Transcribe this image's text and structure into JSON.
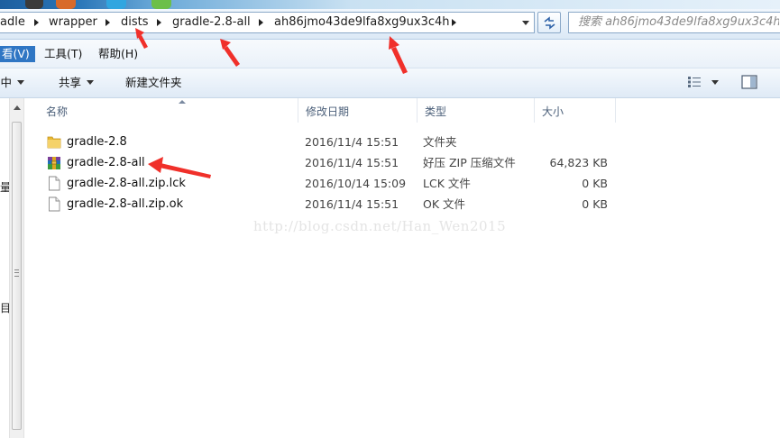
{
  "address_bar": {
    "crumbs": [
      "adle",
      "wrapper",
      "dists",
      "gradle-2.8-all",
      "ah86jmo43de9lfa8xg9ux3c4h"
    ]
  },
  "search": {
    "placeholder": "搜索 ah86jmo43de9lfa8xg9ux3c4h"
  },
  "menu": {
    "view": "看(V)",
    "tools": "工具(T)",
    "help": "帮助(H)"
  },
  "toolbar": {
    "include": "库中",
    "share": "共享",
    "new_folder": "新建文件夹"
  },
  "nav": {
    "fragment_1": "量",
    "fragment_2": "目"
  },
  "columns": {
    "name": "名称",
    "modified": "修改日期",
    "type": "类型",
    "size": "大小"
  },
  "files": [
    {
      "name": "gradle-2.8",
      "modified": "2016/11/4 15:51",
      "type": "文件夹",
      "size": "",
      "icon": "folder-icon"
    },
    {
      "name": "gradle-2.8-all",
      "modified": "2016/11/4 15:51",
      "type": "好压 ZIP 压缩文件",
      "size": "64,823 KB",
      "icon": "zip-archive-icon"
    },
    {
      "name": "gradle-2.8-all.zip.lck",
      "modified": "2016/10/14 15:09",
      "type": "LCK 文件",
      "size": "0 KB",
      "icon": "blank-file-icon"
    },
    {
      "name": "gradle-2.8-all.zip.ok",
      "modified": "2016/11/4 15:51",
      "type": "OK 文件",
      "size": "0 KB",
      "icon": "blank-file-icon"
    }
  ],
  "watermark": "http://blog.csdn.net/Han_Wen2015",
  "colors": {
    "accent": "#2f76c4",
    "annotation_arrow": "#f0302a",
    "folder": "#e8b933"
  }
}
